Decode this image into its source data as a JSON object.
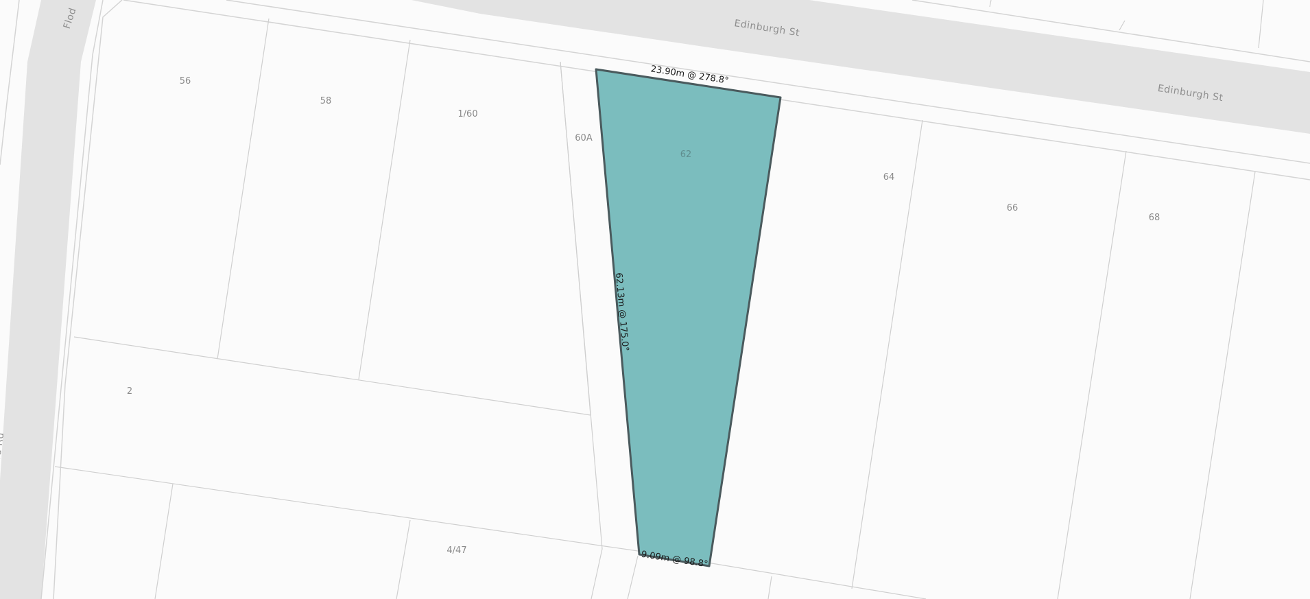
{
  "map": {
    "streets": {
      "edinburgh_1": "Edinburgh St",
      "edinburgh_2": "Edinburgh St",
      "top_left": "Flod",
      "left_side": "ord Rd"
    },
    "lots": {
      "l56": "56",
      "l58": "58",
      "l160": "1/60",
      "l60a": "60A",
      "l64": "64",
      "l66": "66",
      "l68": "68",
      "l2": "2",
      "l447": "4/47"
    },
    "selected_parcel": {
      "number": "62",
      "fill_color": "#7bbdbe",
      "outline_color": "#4a5a5d",
      "measurements": {
        "north": "23.90m @ 278.8°",
        "west": "62.13m @ 175.0°",
        "south": "9.09m @ 98.8°"
      }
    }
  }
}
